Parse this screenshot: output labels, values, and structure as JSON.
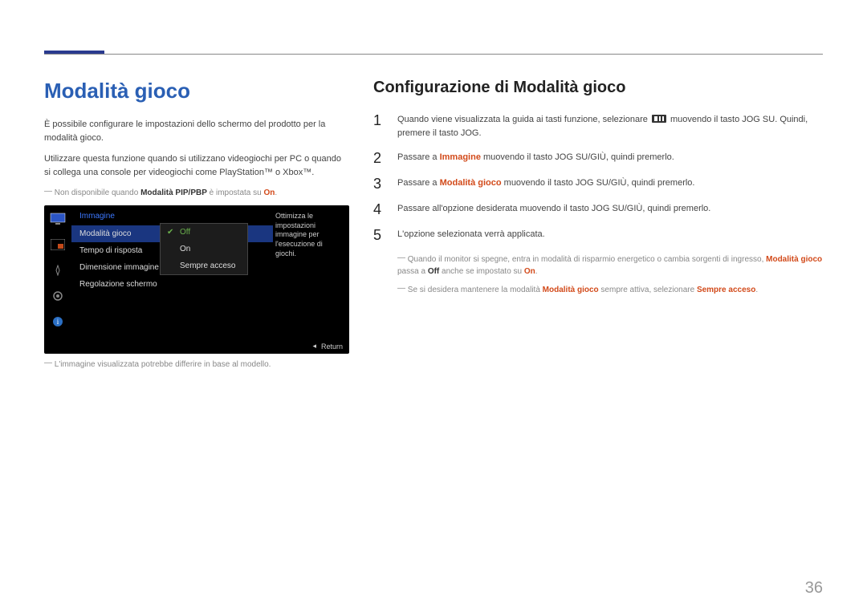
{
  "topbar": {},
  "left": {
    "title": "Modalità gioco",
    "p1": "È possibile configurare le impostazioni dello schermo del prodotto per la modalità gioco.",
    "p2": "Utilizzare questa funzione quando si utilizzano videogiochi per PC o quando si collega una console per videogiochi come PlayStation™ o Xbox™.",
    "note1_pre": "Non disponibile quando ",
    "note1_bold": "Modalità PIP/PBP",
    "note1_mid": " è impostata su ",
    "note1_on": "On",
    "note1_post": ".",
    "note2": "L'immagine visualizzata potrebbe differire in base al modello."
  },
  "osd": {
    "header": "Immagine",
    "row1": "Modalità gioco",
    "row2": "Tempo di risposta",
    "row3": "Dimensione immagine",
    "row4": "Regolazione schermo",
    "sub1": "Off",
    "sub2": "On",
    "sub3": "Sempre acceso",
    "desc": "Ottimizza le impostazioni immagine per l'esecuzione di giochi.",
    "return": "Return"
  },
  "right": {
    "subtitle": "Configurazione di Modalità gioco",
    "step1_a": "Quando viene visualizzata la guida ai tasti funzione, selezionare ",
    "step1_b": " muovendo il tasto JOG SU. Quindi, premere il tasto JOG.",
    "step2_a": "Passare a ",
    "step2_bold": "Immagine",
    "step2_b": " muovendo il tasto JOG SU/GIÙ, quindi premerlo.",
    "step3_a": "Passare a ",
    "step3_bold": "Modalità gioco",
    "step3_b": " muovendo il tasto JOG SU/GIÙ, quindi premerlo.",
    "step4": "Passare all'opzione desiderata muovendo il tasto JOG SU/GIÙ, quindi premerlo.",
    "step5": "L'opzione selezionata verrà applicata.",
    "note3_a": "Quando il monitor si spegne, entra in modalità di risparmio energetico o cambia sorgenti di ingresso, ",
    "note3_bold1": "Modalità gioco",
    "note3_b": " passa a ",
    "note3_bold2": "Off",
    "note3_c": " anche se impostato su ",
    "note3_on": "On",
    "note3_d": ".",
    "note4_a": "Se si desidera mantenere la modalità ",
    "note4_bold1": "Modalità gioco",
    "note4_b": " sempre attiva, selezionare ",
    "note4_bold2": "Sempre acceso",
    "note4_c": "."
  },
  "page_number": "36"
}
